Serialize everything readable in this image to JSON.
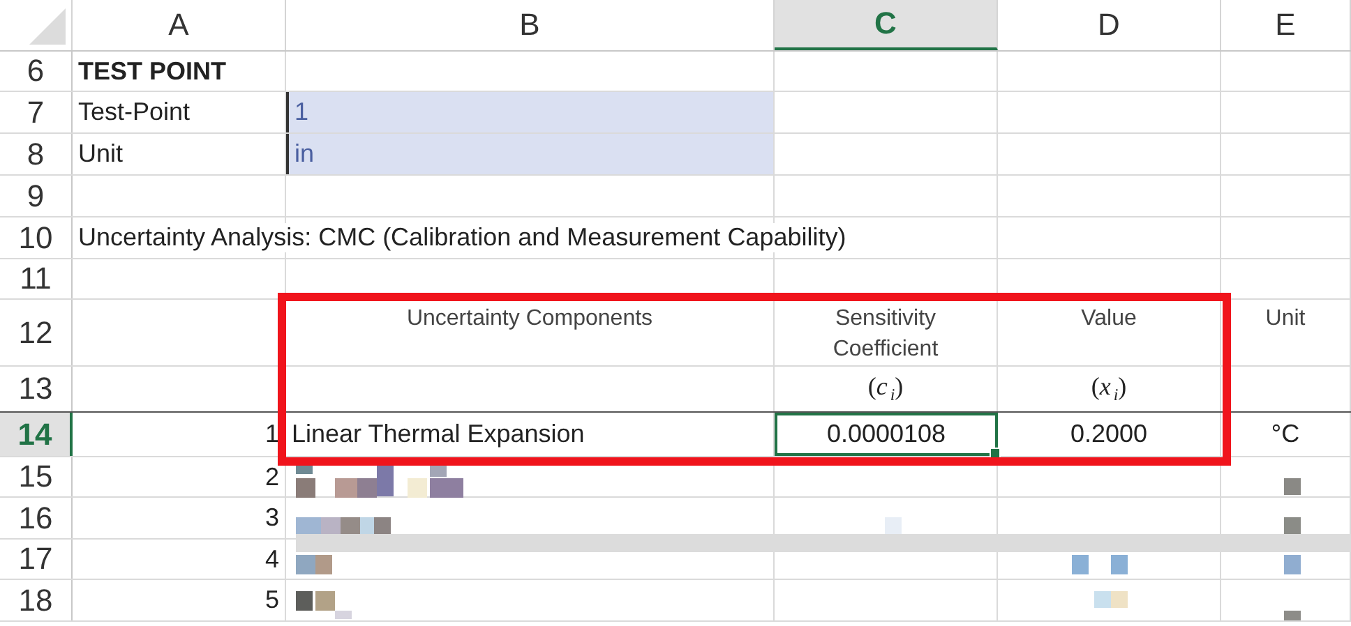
{
  "columns": [
    {
      "label": "A",
      "selected": false
    },
    {
      "label": "B",
      "selected": false
    },
    {
      "label": "C",
      "selected": true
    },
    {
      "label": "D",
      "selected": false
    },
    {
      "label": "E",
      "selected": false
    }
  ],
  "rows": [
    {
      "number": "6",
      "selected": false,
      "cells": {
        "A": {
          "kind": "label",
          "bold": true,
          "selected": false,
          "text": "TEST POINT"
        }
      }
    },
    {
      "number": "7",
      "selected": false,
      "cells": {
        "A": {
          "kind": "label",
          "bold": false,
          "selected": false,
          "text": "Test-Point"
        },
        "B": {
          "kind": "input",
          "bold": false,
          "selected": false,
          "text": "1"
        }
      }
    },
    {
      "number": "8",
      "selected": false,
      "cells": {
        "A": {
          "kind": "label",
          "bold": false,
          "selected": false,
          "text": "Unit"
        },
        "B": {
          "kind": "input",
          "bold": false,
          "selected": false,
          "text": "in"
        }
      }
    },
    {
      "number": "9",
      "selected": false
    },
    {
      "number": "10",
      "selected": false,
      "cells": {
        "A": {
          "kind": "label",
          "bold": false,
          "selected": false,
          "text": "Uncertainty Analysis: CMC (Calibration and Measurement Capability)"
        }
      }
    },
    {
      "number": "11",
      "selected": false
    },
    {
      "number": "12",
      "selected": false,
      "cells": {
        "B": {
          "kind": "header",
          "bold": false,
          "selected": false,
          "text": "Uncertainty Components"
        },
        "C": {
          "kind": "header",
          "bold": false,
          "selected": false,
          "text": "Sensitivity Coefficient"
        },
        "D": {
          "kind": "header",
          "bold": false,
          "selected": false,
          "text": "Value"
        },
        "E": {
          "kind": "header",
          "bold": false,
          "selected": false,
          "text": "Unit"
        }
      }
    },
    {
      "number": "13",
      "selected": false,
      "cells": {
        "C": {
          "kind": "formula",
          "bold": false,
          "selected": false,
          "text": "(*c*$_{i}$)"
        },
        "D": {
          "kind": "formula",
          "bold": false,
          "selected": false,
          "text": "(*x*$_{i}$)"
        }
      }
    },
    {
      "number": "14",
      "selected": true,
      "cells": {
        "A": {
          "kind": "number",
          "bold": false,
          "selected": false,
          "text": "1"
        },
        "B": {
          "kind": "label",
          "bold": false,
          "selected": false,
          "text": "Linear Thermal Expansion"
        },
        "C": {
          "kind": "value",
          "bold": false,
          "selected": true,
          "text": "0.0000108"
        },
        "D": {
          "kind": "value",
          "bold": false,
          "selected": false,
          "text": "0.2000"
        },
        "E": {
          "kind": "value",
          "bold": false,
          "selected": false,
          "text": "°C"
        }
      }
    },
    {
      "number": "15",
      "selected": false,
      "cells": {
        "A": {
          "kind": "number",
          "bold": false,
          "selected": false,
          "text": "2"
        }
      }
    },
    {
      "number": "16",
      "selected": false,
      "cells": {
        "A": {
          "kind": "number",
          "bold": false,
          "selected": false,
          "text": "3"
        }
      }
    },
    {
      "number": "17",
      "selected": false,
      "cells": {
        "A": {
          "kind": "number",
          "bold": false,
          "selected": false,
          "text": "4"
        }
      }
    },
    {
      "number": "18",
      "selected": false,
      "cells": {
        "A": {
          "kind": "number",
          "bold": false,
          "selected": false,
          "text": "5"
        }
      }
    }
  ]
}
